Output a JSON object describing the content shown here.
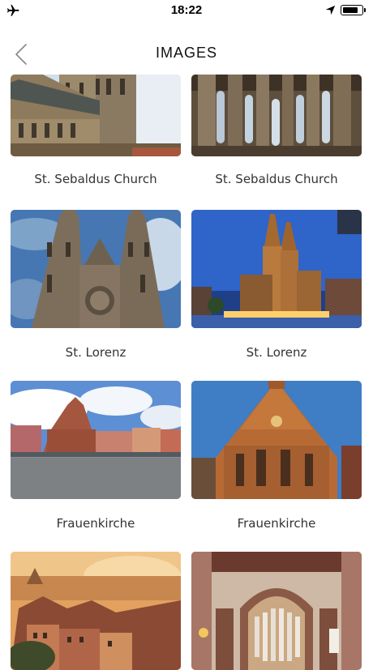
{
  "status_bar": {
    "time": "18:22",
    "airplane_mode_icon": "airplane-icon",
    "location_icon": "location-arrow-icon",
    "battery_level": 0.85
  },
  "nav": {
    "title": "IMAGES",
    "back_icon": "chevron-left-icon"
  },
  "gallery": {
    "items": [
      {
        "caption": "St. Sebaldus Church",
        "scene": "church exterior"
      },
      {
        "caption": "St. Sebaldus Church",
        "scene": "gothic interior columns"
      },
      {
        "caption": "St. Lorenz",
        "scene": "twin spire facade"
      },
      {
        "caption": "St. Lorenz",
        "scene": "church at dusk"
      },
      {
        "caption": "Frauenkirche",
        "scene": "market square"
      },
      {
        "caption": "Frauenkirche",
        "scene": "gothic gable facade"
      },
      {
        "caption": "",
        "scene": "old town at sunrise"
      },
      {
        "caption": "",
        "scene": "church organ interior"
      }
    ]
  }
}
